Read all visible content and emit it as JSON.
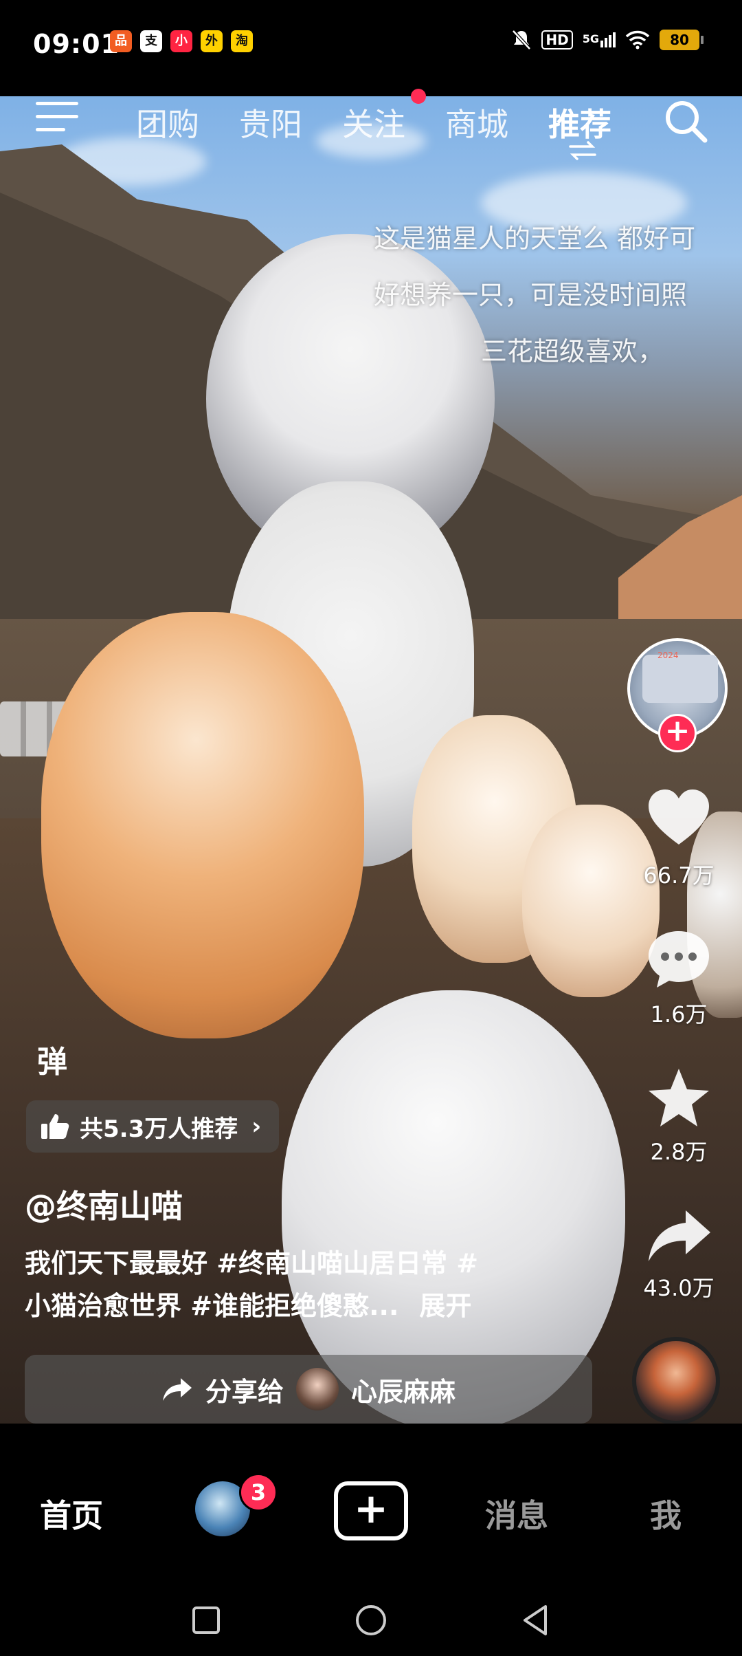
{
  "status_bar": {
    "time": "09:01",
    "network": "5G",
    "hd": "HD",
    "battery": "80",
    "apps": [
      {
        "name": "meituan-icon",
        "color": "#f25d22",
        "text": "品"
      },
      {
        "name": "alipay-icon",
        "color": "#ffffff",
        "text": "支"
      },
      {
        "name": "xiaohongshu-icon",
        "color": "#ff2442",
        "text": "小"
      },
      {
        "name": "meituan-waimai-icon",
        "color": "#ffd100",
        "text": "外"
      },
      {
        "name": "taotao-icon",
        "color": "#ffd100",
        "text": "淘"
      }
    ]
  },
  "top_nav": {
    "tabs": [
      {
        "label": "团购",
        "active": false
      },
      {
        "label": "贵阳",
        "active": false
      },
      {
        "label": "关注",
        "active": false
      },
      {
        "label": "商城",
        "active": false
      },
      {
        "label": "推荐",
        "active": true
      }
    ]
  },
  "danmu": [
    "这是猫星人的天堂么 都好可",
    "好想养一只，可是没时间照",
    "三花超级喜欢，"
  ],
  "right_rail": {
    "likes": "66.7万",
    "comments": "1.6万",
    "favorites": "2.8万",
    "shares": "43.0万"
  },
  "video_info": {
    "danmu_toggle": "弹",
    "recommend": "共5.3万人推荐",
    "author": "@终南山喵",
    "desc_text": "我们天下最最好 ",
    "tag1": "#终南山喵山居日常",
    "tag2": " #",
    "tag3": "小猫治愈世界",
    "tag4": " #谁能拒绝傻憨...",
    "expand": "展开"
  },
  "share_bar": {
    "label": "分享给",
    "friend": "心辰麻麻"
  },
  "bottom_nav": {
    "home": "首页",
    "friend_badge": "3",
    "messages": "消息",
    "me": "我"
  },
  "colors": {
    "accent": "#fe2c55",
    "battery": "#e3a90b"
  }
}
